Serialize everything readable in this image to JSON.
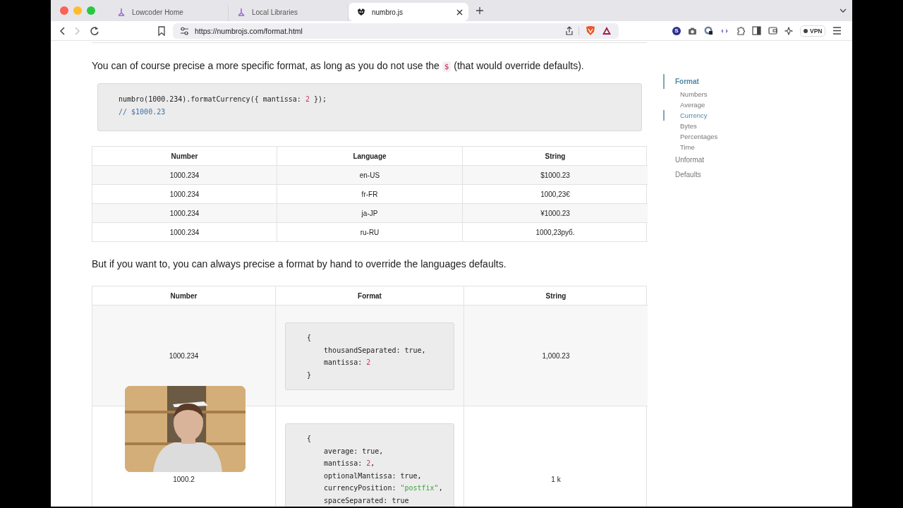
{
  "browser": {
    "tabs": [
      {
        "title": "Lowcoder Home",
        "selected": false,
        "kind": "lowcoder"
      },
      {
        "title": "Local Libraries",
        "selected": false,
        "kind": "lowcoder"
      },
      {
        "title": "numbro.js",
        "selected": true,
        "kind": "numbro"
      }
    ],
    "nav_buttons": [
      {
        "kind": "back",
        "disabled": false
      },
      {
        "kind": "forward",
        "disabled": true
      },
      {
        "kind": "reload",
        "disabled": false
      }
    ],
    "url": "https://numbrojs.com/format.html",
    "profile_initial": "S",
    "vpn_label": "VPN"
  },
  "intro": {
    "before": "You can of course precise a more specific format, as long as you do not use the ",
    "code": "$",
    "after": " (that would override defaults)."
  },
  "code_block": [
    [
      {
        "text": "numbro(1000.234).formatCurrency({ mantissa: ",
        "kind": "plain"
      },
      {
        "text": "2",
        "kind": "number"
      },
      {
        "text": " });",
        "kind": "plain"
      }
    ],
    [
      {
        "text": "// $1000.23",
        "kind": "comment"
      }
    ]
  ],
  "table_languages": {
    "columns": [
      "Number",
      "Language",
      "String"
    ],
    "rows": [
      [
        "1000.234",
        "en-US",
        "$1000.23"
      ],
      [
        "1000.234",
        "fr-FR",
        "1000,23€"
      ],
      [
        "1000.234",
        "ja-JP",
        "¥1000.23"
      ],
      [
        "1000.234",
        "ru-RU",
        "1000,23руб."
      ]
    ]
  },
  "paragraph": "But if you want to, you can always precise a format by hand to override the languages defaults.",
  "table_formats": {
    "columns": [
      "Number",
      "Format",
      "String"
    ],
    "rows": [
      {
        "number": "1000.234",
        "string": "1,000.23",
        "format": [
          [
            {
              "text": "{",
              "kind": "plain"
            }
          ],
          [
            {
              "text": "    thousandSeparated: true,",
              "kind": "plain"
            }
          ],
          [
            {
              "text": "    mantissa: ",
              "kind": "plain"
            },
            {
              "text": "2",
              "kind": "number"
            }
          ],
          [
            {
              "text": "}",
              "kind": "plain"
            }
          ]
        ]
      },
      {
        "number": "1000.2",
        "string": "1 k",
        "format": [
          [
            {
              "text": "{",
              "kind": "plain"
            }
          ],
          [
            {
              "text": "    average: true,",
              "kind": "plain"
            }
          ],
          [
            {
              "text": "    mantissa: ",
              "kind": "plain"
            },
            {
              "text": "2",
              "kind": "number"
            },
            {
              "text": ",",
              "kind": "plain"
            }
          ],
          [
            {
              "text": "    optionalMantissa: true,",
              "kind": "plain"
            }
          ],
          [
            {
              "text": "    currencyPosition: ",
              "kind": "plain"
            },
            {
              "text": "\"postfix\"",
              "kind": "string"
            },
            {
              "text": ",",
              "kind": "plain"
            }
          ],
          [
            {
              "text": "    spaceSeparated: true",
              "kind": "plain"
            }
          ]
        ]
      }
    ],
    "overlay": {
      "kind": "picture"
    }
  },
  "toc": [
    {
      "label": "Format",
      "selected": true,
      "children": [
        {
          "label": "Numbers",
          "selected": false
        },
        {
          "label": "Average",
          "selected": false
        },
        {
          "label": "Currency",
          "selected": true
        },
        {
          "label": "Bytes",
          "selected": false
        },
        {
          "label": "Percentages",
          "selected": false
        },
        {
          "label": "Time",
          "selected": false
        }
      ]
    },
    {
      "label": "Unformat",
      "selected": false
    },
    {
      "label": "Defaults",
      "selected": false
    }
  ]
}
